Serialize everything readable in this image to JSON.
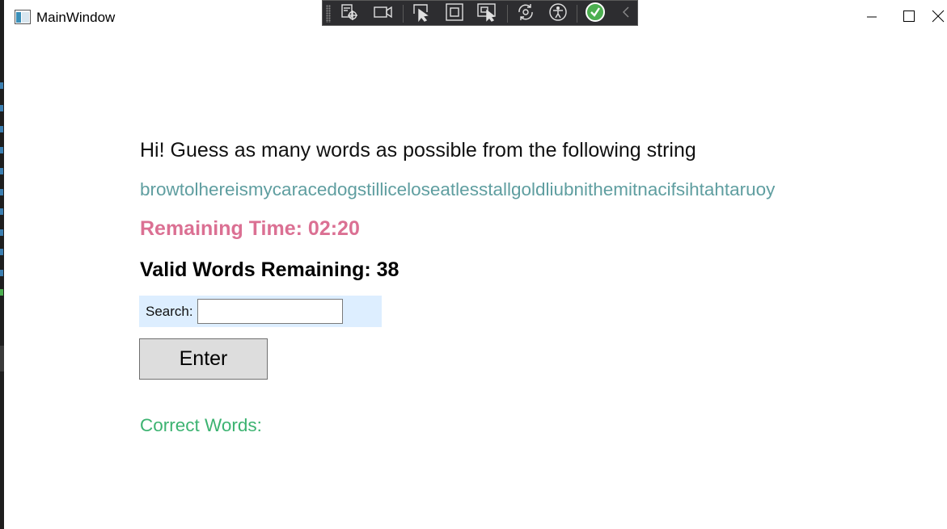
{
  "window": {
    "title": "MainWindow",
    "icon": "app-window-icon",
    "controls": {
      "minimize_icon": "minimize-icon",
      "maximize_icon": "maximize-icon",
      "close_icon": "close-icon"
    }
  },
  "debug_toolbar": {
    "tools": [
      {
        "icon": "live-visual-tree-icon"
      },
      {
        "icon": "video-camera-icon"
      },
      {
        "icon": "select-element-icon"
      },
      {
        "icon": "display-layout-adorners-icon"
      },
      {
        "icon": "track-focused-element-icon"
      },
      {
        "icon": "hot-reload-icon"
      },
      {
        "icon": "accessibility-icon"
      },
      {
        "icon": "check-circle-icon"
      },
      {
        "icon": "collapse-chevron-icon"
      }
    ],
    "colors": {
      "background": "#2d2d30",
      "check": "#4caf50"
    }
  },
  "main": {
    "greeting": "Hi! Guess as many words as possible from the following string",
    "letter_string": "browtolhereismycaracedogstilliceloseatlesstallgoldliubnithemitnacifsihtahtaruoy",
    "remaining_time": "Remaining Time: 02:20",
    "valid_words_remaining": "Valid Words Remaining: 38",
    "search": {
      "label": "Search:",
      "value": "",
      "placeholder": ""
    },
    "enter_button_label": "Enter",
    "correct_words_label": "Correct Words:"
  },
  "colors": {
    "letter_string": "#5f9ea0",
    "remaining_time": "#db7093",
    "correct_words": "#3cb371",
    "search_panel": "#ddeeff",
    "button": "#dddddd"
  }
}
